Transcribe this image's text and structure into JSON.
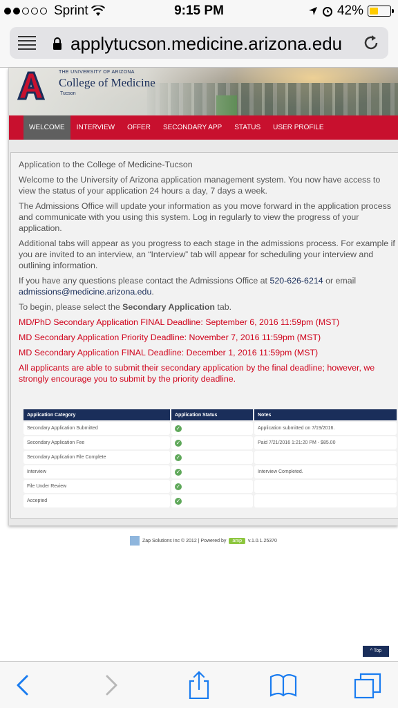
{
  "status_bar": {
    "carrier": "Sprint",
    "time": "9:15 PM",
    "battery": "42%",
    "battery_level": 0.42
  },
  "browser": {
    "url": "applytucson.medicine.arizona.edu"
  },
  "header": {
    "university": "THE UNIVERSITY OF ARIZONA",
    "college": "College of Medicine",
    "campus": "Tucson"
  },
  "nav": {
    "items": [
      {
        "label": "WELCOME"
      },
      {
        "label": "INTERVIEW"
      },
      {
        "label": "OFFER"
      },
      {
        "label": "SECONDARY APP"
      },
      {
        "label": "STATUS"
      },
      {
        "label": "USER PROFILE"
      }
    ]
  },
  "content": {
    "heading": "Application to the College of Medicine-Tucson",
    "p1": "Welcome to the University of Arizona application management system. You now have access to view the status of your application 24 hours a day, 7 days a week.",
    "p2": "The Admissions Office will update your information as you move forward in the application process and communicate with you using this system. Log in regularly to view the progress of your application.",
    "p3": "Additional tabs will appear as you progress to each stage in the admissions process. For example if you are invited to an interview, an “Interview” tab will appear for scheduling your interview and outlining information.",
    "p4_pre": "If you have any questions please contact the Admissions Office at ",
    "phone": "520-626-6214",
    "p4_mid": " or email ",
    "email": "admissions@medicine.arizona.edu",
    "p4_post": ".",
    "p5_pre": "To begin, please select the ",
    "p5_bold": "Secondary Application",
    "p5_post": " tab.",
    "deadline1": "MD/PhD Secondary Application FINAL Deadline: September 6, 2016 11:59pm (MST)",
    "deadline2": "MD Secondary Application Priority Deadline: November 7, 2016 11:59pm (MST)",
    "deadline3": "MD Secondary Application FINAL Deadline: December 1, 2016 11:59pm (MST)",
    "notice": "All applicants are able to submit their secondary application by the final deadline; however, we strongly encourage you to submit by the priority deadline."
  },
  "table": {
    "headers": [
      "Application Category",
      "Application Status",
      "Notes"
    ],
    "rows": [
      {
        "category": "Secondary Application Submitted",
        "status": "check",
        "notes": "Application submitted on 7/19/2016."
      },
      {
        "category": "Secondary Application Fee",
        "status": "check",
        "notes": "Paid 7/21/2016 1:21:20 PM - $85.00"
      },
      {
        "category": "Secondary Application File Complete",
        "status": "check",
        "notes": ""
      },
      {
        "category": "Interview",
        "status": "check",
        "notes": "Interview Completed."
      },
      {
        "category": "File Under Review",
        "status": "check",
        "notes": ""
      },
      {
        "category": "Accepted",
        "status": "check",
        "notes": ""
      }
    ]
  },
  "footer": {
    "text": "Zap Solutions Inc © 2012 | Powered by",
    "badge": "amp",
    "version": "v.1.0.1.25370"
  },
  "top_button": "^ Top",
  "colors": {
    "nav_red": "#c8102e",
    "navy": "#1a2e5a",
    "deadline_red": "#d0021b",
    "ios_blue": "#1a7cf0"
  }
}
